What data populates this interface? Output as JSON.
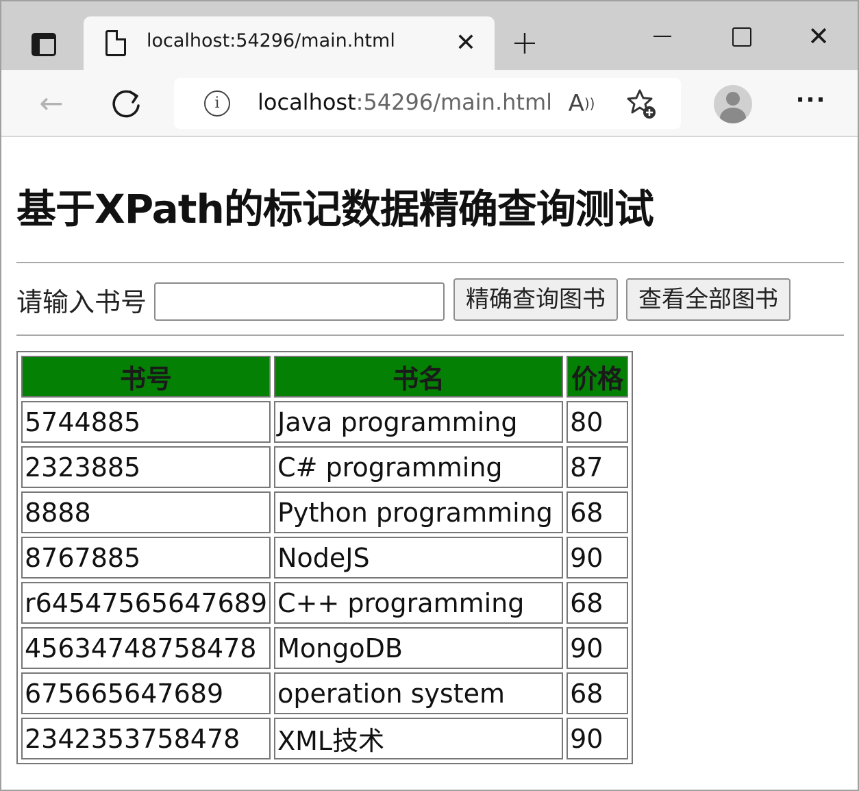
{
  "browser": {
    "tab_title": "localhost:54296/main.html",
    "tab_close": "✕",
    "new_tab": "+",
    "url_host": "localhost",
    "url_rest": ":54296/main.html",
    "icons": [
      "tab-actions-icon",
      "page-icon",
      "close-icon",
      "plus-icon",
      "minimize-icon",
      "maximize-icon",
      "close-window-icon",
      "back-arrow-icon",
      "reload-icon",
      "info-icon",
      "read-aloud-icon",
      "add-favorite-icon",
      "profile-icon",
      "more-icon"
    ]
  },
  "page": {
    "title": "基于XPath的标记数据精确查询测试",
    "query_label": "请输入书号",
    "query_value": "",
    "exact_button": "精确查询图书",
    "all_button": "查看全部图书"
  },
  "table": {
    "headers": [
      "书号",
      "书名",
      "价格"
    ],
    "header_color": "#048004",
    "rows": [
      [
        "5744885",
        "Java programming",
        "80"
      ],
      [
        "2323885",
        "C# programming",
        "87"
      ],
      [
        "8888",
        "Python programming",
        "68"
      ],
      [
        "8767885",
        "NodeJS",
        "90"
      ],
      [
        "r64547565647689",
        "C++ programming",
        "68"
      ],
      [
        "45634748758478",
        "MongoDB",
        "90"
      ],
      [
        "675665647689",
        "operation system",
        "68"
      ],
      [
        "2342353758478",
        "XML技术",
        "90"
      ]
    ]
  }
}
